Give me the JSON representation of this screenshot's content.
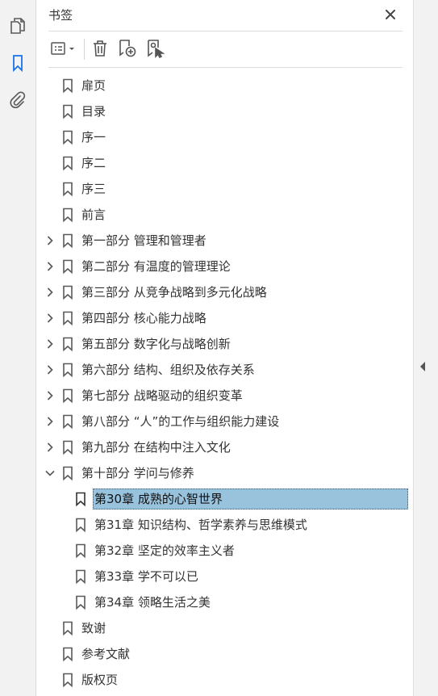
{
  "panel": {
    "title": "书签"
  },
  "colors": {
    "selection": "#99c3dd",
    "icon": "#5a5a5a",
    "rail_active": "#1a73e8"
  },
  "rail": {
    "icons": [
      "pages-icon",
      "bookmark-icon",
      "attachment-icon"
    ]
  },
  "toolbar": {
    "icons": [
      "options-menu-icon",
      "delete-icon",
      "new-bookmark-icon",
      "bookmark-from-selection-icon"
    ]
  },
  "bookmarks": [
    {
      "label": "扉页"
    },
    {
      "label": "目录"
    },
    {
      "label": "序一"
    },
    {
      "label": "序二"
    },
    {
      "label": "序三"
    },
    {
      "label": "前言"
    },
    {
      "label": "第一部分 管理和管理者",
      "expandable": true
    },
    {
      "label": "第二部分 有温度的管理理论",
      "expandable": true
    },
    {
      "label": "第三部分 从竞争战略到多元化战略",
      "expandable": true
    },
    {
      "label": "第四部分 核心能力战略",
      "expandable": true
    },
    {
      "label": "第五部分 数字化与战略创新",
      "expandable": true
    },
    {
      "label": "第六部分 结构、组织及依存关系",
      "expandable": true
    },
    {
      "label": "第七部分 战略驱动的组织变革",
      "expandable": true
    },
    {
      "label": "第八部分 “人”的工作与组织能力建设",
      "expandable": true
    },
    {
      "label": "第九部分 在结构中注入文化",
      "expandable": true
    },
    {
      "label": "第十部分 学问与修养",
      "expandable": true,
      "expanded": true
    },
    {
      "label": "第30章 成熟的心智世界",
      "child": true,
      "selected": true
    },
    {
      "label": "第31章 知识结构、哲学素养与思维模式",
      "child": true
    },
    {
      "label": "第32章 坚定的效率主义者",
      "child": true
    },
    {
      "label": "第33章 学不可以已",
      "child": true
    },
    {
      "label": "第34章 领略生活之美",
      "child": true
    },
    {
      "label": "致谢"
    },
    {
      "label": "参考文献"
    },
    {
      "label": "版权页"
    }
  ]
}
